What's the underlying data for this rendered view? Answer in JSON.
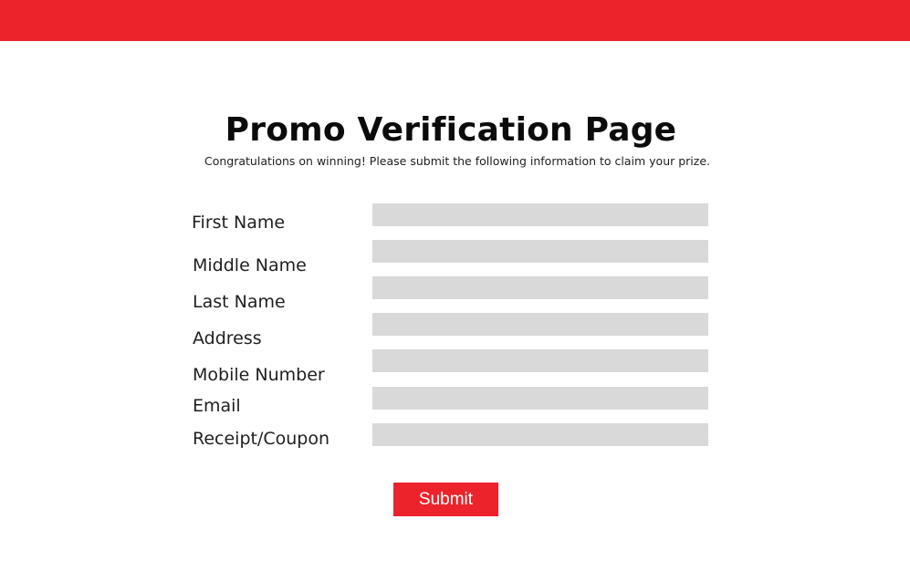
{
  "page": {
    "title": "Promo Verification Page",
    "subtitle": "Congratulations on winning! Please submit the following information to claim your prize."
  },
  "form": {
    "fields": [
      {
        "label": "First Name",
        "value": ""
      },
      {
        "label": "Middle Name",
        "value": ""
      },
      {
        "label": "Last Name",
        "value": ""
      },
      {
        "label": "Address",
        "value": ""
      },
      {
        "label": "Mobile Number",
        "value": ""
      },
      {
        "label": "Email",
        "value": ""
      },
      {
        "label": "Receipt/Coupon",
        "value": ""
      }
    ],
    "submit_label": "Submit"
  },
  "colors": {
    "accent": "#ec232b",
    "field_background": "#d9d9d9",
    "page_background": "#ffffff"
  }
}
